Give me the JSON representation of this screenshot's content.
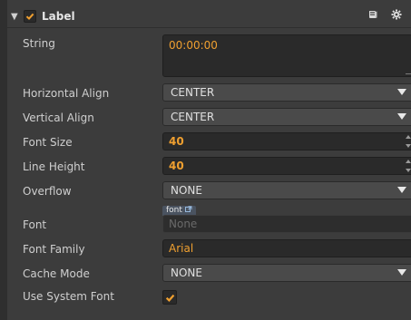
{
  "component": {
    "title": "Label",
    "enabled": true
  },
  "header_icons": [
    "book-icon",
    "gear-icon"
  ],
  "properties": {
    "string": {
      "label": "String",
      "value": "00:00:00"
    },
    "horizontal_align": {
      "label": "Horizontal Align",
      "value": "CENTER"
    },
    "vertical_align": {
      "label": "Vertical Align",
      "value": "CENTER"
    },
    "font_size": {
      "label": "Font Size",
      "value": "40"
    },
    "line_height": {
      "label": "Line Height",
      "value": "40"
    },
    "overflow": {
      "label": "Overflow",
      "value": "NONE"
    },
    "font": {
      "label": "Font",
      "tag": "font",
      "value": "None"
    },
    "font_family": {
      "label": "Font Family",
      "value": "Arial"
    },
    "cache_mode": {
      "label": "Cache Mode",
      "value": "NONE"
    },
    "use_system_font": {
      "label": "Use System Font",
      "checked": true
    }
  },
  "colors": {
    "accent": "#f0a030",
    "panel_bg": "#3c3c3c",
    "field_bg": "#2a2a2a"
  }
}
